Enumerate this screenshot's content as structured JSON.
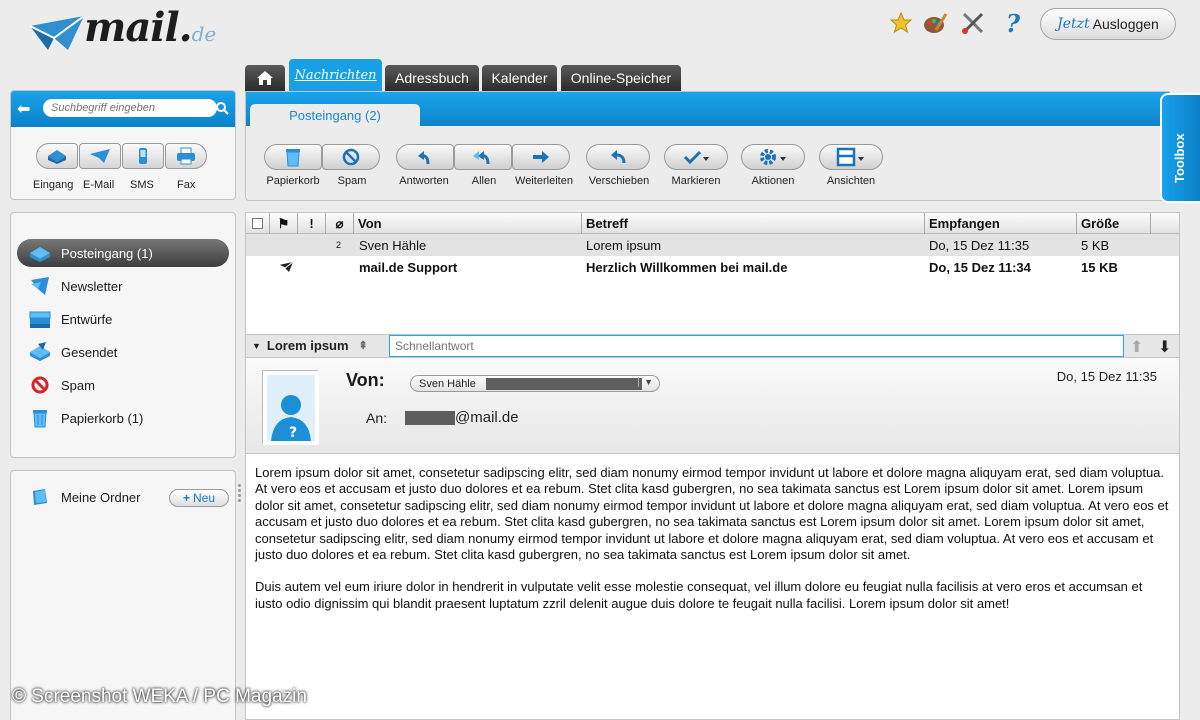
{
  "header": {
    "logo_text": "mail.",
    "logo_tld": "de",
    "logout_prefix": "Jetzt",
    "logout_label": "Ausloggen",
    "top_icons": [
      "star-icon",
      "palette-icon",
      "tools-icon",
      "help-icon"
    ]
  },
  "search": {
    "placeholder": "Suchbegriff eingeben"
  },
  "compose": {
    "items": [
      {
        "label": "Eingang",
        "icon": "inbox-icon"
      },
      {
        "label": "E-Mail",
        "icon": "mail-icon"
      },
      {
        "label": "SMS",
        "icon": "phone-icon"
      },
      {
        "label": "Fax",
        "icon": "fax-icon"
      }
    ]
  },
  "folders": {
    "items": [
      {
        "label": "Posteingang (1)",
        "icon": "inbox-icon"
      },
      {
        "label": "Newsletter",
        "icon": "newsletter-icon"
      },
      {
        "label": "Entwürfe",
        "icon": "drafts-icon"
      },
      {
        "label": "Gesendet",
        "icon": "sent-icon"
      },
      {
        "label": "Spam",
        "icon": "spam-icon"
      },
      {
        "label": "Papierkorb (1)",
        "icon": "trash-icon"
      }
    ]
  },
  "my_folders": {
    "label": "Meine Ordner",
    "new_label": "Neu"
  },
  "tabs": {
    "items": [
      "Nachrichten",
      "Adressbuch",
      "Kalender",
      "Online-Speicher"
    ],
    "active": "Nachrichten"
  },
  "toolbar": {
    "subtab": "Posteingang (2)",
    "buttons": [
      {
        "label": "Papierkorb",
        "icon": "trash-icon"
      },
      {
        "label": "Spam",
        "icon": "spam-icon"
      },
      {
        "label": "Antworten",
        "icon": "reply-icon"
      },
      {
        "label": "Allen",
        "icon": "reply-all-icon"
      },
      {
        "label": "Weiterleiten",
        "icon": "forward-icon"
      },
      {
        "label": "Verschieben",
        "icon": "move-icon"
      },
      {
        "label": "Markieren",
        "icon": "check-icon"
      },
      {
        "label": "Aktionen",
        "icon": "gear-icon"
      },
      {
        "label": "Ansichten",
        "icon": "layout-icon"
      }
    ],
    "toolbox_label": "Toolbox"
  },
  "message_list": {
    "columns": [
      "Von",
      "Betreff",
      "Empfangen",
      "Größe"
    ],
    "rows": [
      {
        "count": "2",
        "from": "Sven Hähle",
        "subject": "Lorem ipsum",
        "received": "Do, 15 Dez 11:35",
        "size": "5 KB",
        "unread": false
      },
      {
        "count": "",
        "from": "mail.de Support",
        "subject": "Herzlich Willkommen bei mail.de",
        "received": "Do, 15 Dez 11:34",
        "size": "15 KB",
        "unread": true
      }
    ]
  },
  "reader": {
    "subject": "Lorem ipsum",
    "quick_reply_placeholder": "Schnellantwort",
    "from_label": "Von:",
    "from_name": "Sven Hähle",
    "to_label": "An:",
    "to_domain": "@mail.de",
    "date": "Do, 15 Dez 11:35",
    "body": [
      "Lorem ipsum dolor sit amet, consetetur sadipscing elitr, sed diam nonumy eirmod tempor invidunt ut labore et dolore magna aliquyam erat, sed diam voluptua. At vero eos et accusam et justo duo dolores et ea rebum. Stet clita kasd gubergren, no sea takimata sanctus est Lorem ipsum dolor sit amet. Lorem ipsum dolor sit amet, consetetur sadipscing elitr, sed diam nonumy eirmod tempor invidunt ut labore et dolore magna aliquyam erat, sed diam voluptua. At vero eos et accusam et justo duo dolores et ea rebum. Stet clita kasd gubergren, no sea takimata sanctus est Lorem ipsum dolor sit amet. Lorem ipsum dolor sit amet, consetetur sadipscing elitr, sed diam nonumy eirmod tempor invidunt ut labore et dolore magna aliquyam erat, sed diam voluptua. At vero eos et accusam et justo duo dolores et ea rebum. Stet clita kasd gubergren, no sea takimata sanctus est Lorem ipsum dolor sit amet.",
      "Duis autem vel eum iriure dolor in hendrerit in vulputate velit esse molestie consequat, vel illum dolore eu feugiat nulla facilisis at vero eros et accumsan et iusto odio dignissim qui blandit praesent luptatum zzril delenit augue duis dolore te feugait nulla facilisi. Lorem ipsum dolor sit amet!"
    ]
  },
  "credit": "© Screenshot WEKA / PC Magazin",
  "colors": {
    "accent": "#0e8fd9",
    "tab_dark": "#333333",
    "active_folder": "#555555"
  }
}
